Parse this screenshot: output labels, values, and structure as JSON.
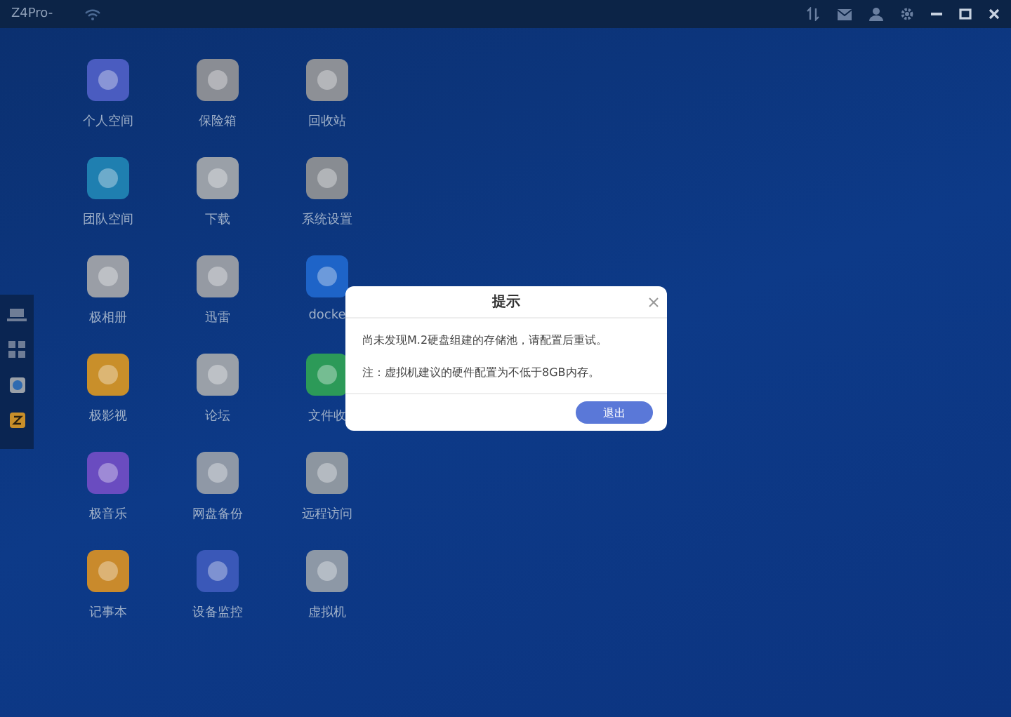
{
  "window": {
    "title": "Z4Pro-"
  },
  "desktop": {
    "apps": [
      {
        "label": "个人空间"
      },
      {
        "label": "保险箱"
      },
      {
        "label": "回收站"
      },
      {
        "label": "团队空间"
      },
      {
        "label": "下载"
      },
      {
        "label": "系统设置"
      },
      {
        "label": "极相册"
      },
      {
        "label": "迅雷"
      },
      {
        "label": "docke"
      },
      {
        "label": "极影视"
      },
      {
        "label": "论坛"
      },
      {
        "label": "文件收"
      },
      {
        "label": "极音乐"
      },
      {
        "label": "网盘备份"
      },
      {
        "label": "远程访问"
      },
      {
        "label": "记事本"
      },
      {
        "label": "设备监控"
      },
      {
        "label": "虚拟机"
      }
    ]
  },
  "dialog": {
    "title": "提示",
    "messages": [
      "尚未发现M.2硬盘组建的存储池，请配置后重试。",
      "注：虚拟机建议的硬件配置为不低于8GB内存。"
    ],
    "button": "退出"
  }
}
